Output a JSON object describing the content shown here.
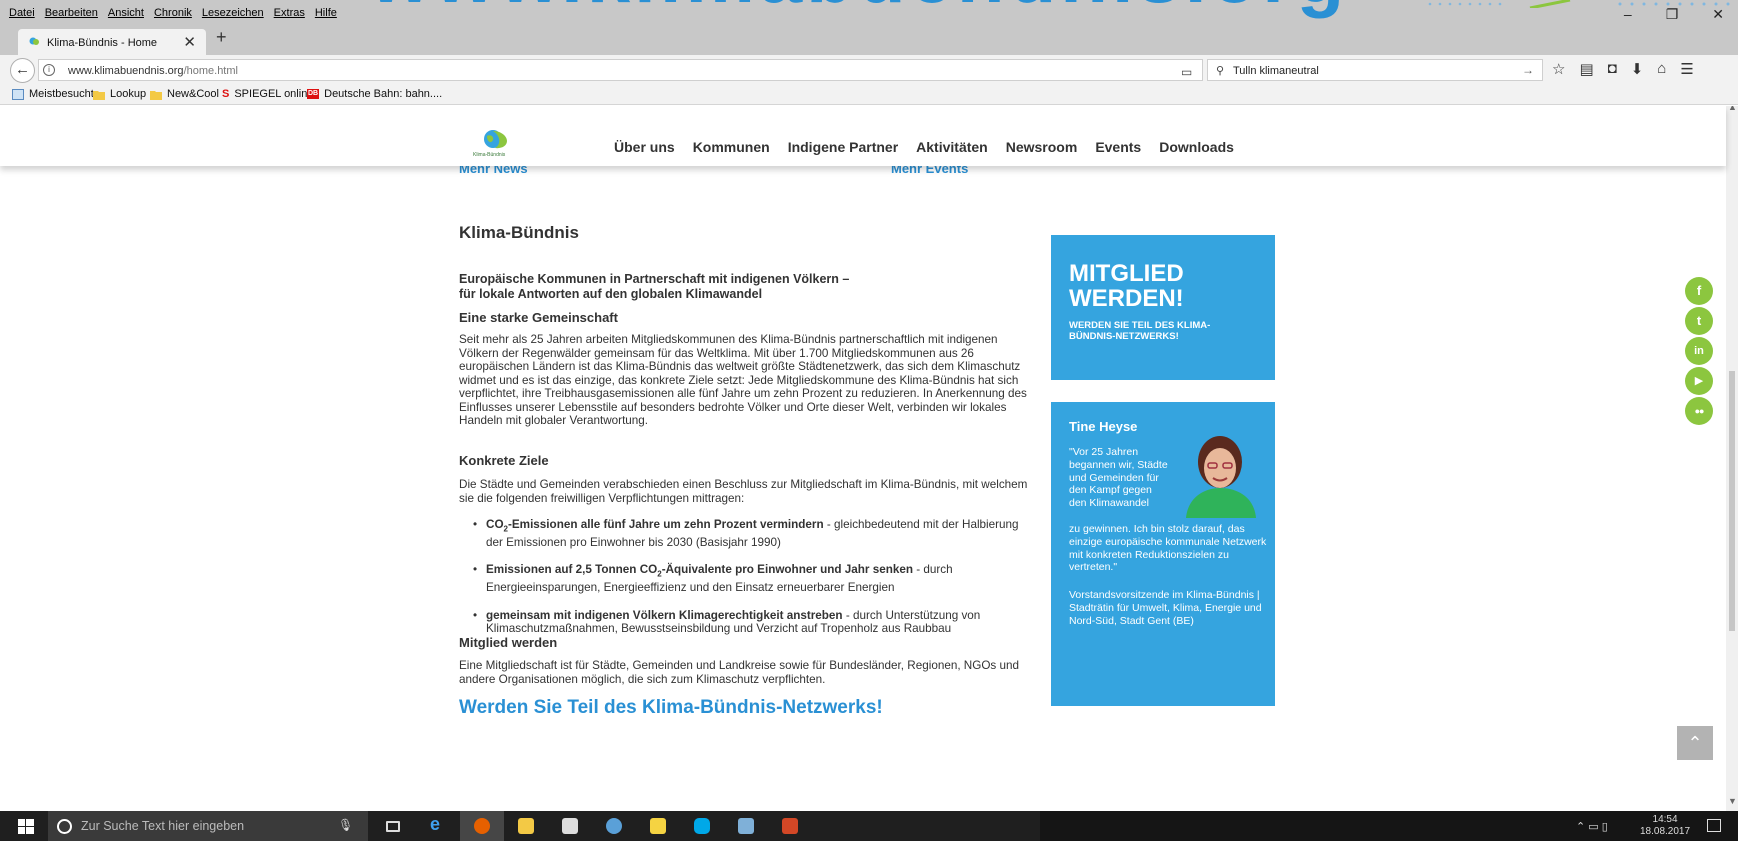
{
  "menu": [
    "Datei",
    "Bearbeiten",
    "Ansicht",
    "Chronik",
    "Lesezeichen",
    "Extras",
    "Hilfe"
  ],
  "banner_text": "www.klimabuendnis.org",
  "tab": {
    "title": "Klima-Bündnis - Home",
    "close": "✕",
    "new": "+"
  },
  "window_controls": {
    "minimize": "–",
    "restore": "❐",
    "close": "✕"
  },
  "address": {
    "host": "www.klimabuendnis.org",
    "path": "/home.html"
  },
  "search": {
    "value": "Tulln klimaneutral"
  },
  "bookmarks": [
    "Meistbesucht",
    "Lookup",
    "New&Cool",
    "SPIEGEL online",
    "Deutsche Bahn: bahn...."
  ],
  "site": {
    "logo_text": "Klima-Bündnis",
    "nav": [
      "Über uns",
      "Kommunen",
      "Indigene Partner",
      "Aktivitäten",
      "Newsroom",
      "Events",
      "Downloads"
    ],
    "more_news": "Mehr News",
    "more_events": "Mehr Events"
  },
  "content": {
    "title": "Klima-Bündnis",
    "lead_1": "Europäische Kommunen in Partnerschaft mit indigenen Völkern –",
    "lead_2": "für lokale Antworten auf den globalen Klimawandel",
    "h_community": "Eine starke Gemeinschaft",
    "p_community": "Seit mehr als 25 Jahren arbeiten Mitgliedskommunen des Klima-Bündnis partnerschaftlich mit indigenen Völkern der Regenwälder gemeinsam für das Weltklima. Mit über 1.700 Mitgliedskommunen aus 26 europäischen Ländern ist das Klima-Bündnis das weltweit größte Städtenetzwerk, das sich dem Klimaschutz widmet und es ist das einzige, das konkrete Ziele setzt: Jede Mitgliedskommune des Klima-Bündnis hat sich verpflichtet, ihre Treibhausgasemissionen alle fünf Jahre um zehn Prozent zu reduzieren. In Anerkennung des Einflusses unserer Lebensstile auf besonders bedrohte Völker und Orte dieser Welt, verbinden wir lokales Handeln mit globaler Verantwortung.",
    "h_goals": "Konkrete Ziele",
    "p_goals": "Die Städte und Gemeinden verabschieden einen Beschluss zur Mitgliedschaft im Klima-Bündnis, mit welchem sie die folgenden freiwilligen Verpflichtungen mittragen:",
    "goal_1_bold_a": "CO",
    "goal_1_sub": "2",
    "goal_1_bold_b": "-Emissionen alle fünf Jahre um zehn Prozent vermindern",
    "goal_1_rest": " - gleichbedeutend mit der Halbierung der Emissionen pro Einwohner bis 2030 (Basisjahr 1990)",
    "goal_2_bold_a": "Emissionen auf 2,5 Tonnen CO",
    "goal_2_sub": "2",
    "goal_2_bold_b": "-Äquivalente pro Einwohner und Jahr senken",
    "goal_2_rest": " - durch Energieeinsparungen, Energieeffizienz und den Einsatz erneuerbarer Energien",
    "goal_3_bold": "gemeinsam mit indigenen Völkern Klimagerechtigkeit anstreben",
    "goal_3_rest": " - durch Unterstützung von Klimaschutzmaßnahmen, Bewusstseinsbildung und Verzicht auf Tropenholz aus Raubbau",
    "h_member": "Mitglied werden",
    "p_member": "Eine Mitgliedschaft ist für Städte, Gemeinden und Landkreise sowie für Bundesländer, Regionen, NGOs und andere Organisationen möglich, die sich zum Klimaschutz verpflichten.",
    "cta": "Werden Sie Teil des Klima-Bündnis-Netzwerks!"
  },
  "sidebar": {
    "member_big_1": "MITGLIED",
    "member_big_2": "WERDEN!",
    "member_small": "WERDEN SIE TEIL DES KLIMA-BÜNDNIS-NETZWERKS!",
    "quote_name": "Tine Heyse",
    "quote_1": "\"Vor 25 Jahren begannen wir, Städte und Gemeinden für den Kampf gegen den Klimawandel",
    "quote_2": "zu gewinnen. Ich bin stolz darauf, das einzige europäische kommunale Netzwerk mit konkreten Reduktionszielen zu vertreten.\"",
    "quote_role": "Vorstandsvorsitzende im Klima-Bündnis | Stadträtin für Umwelt, Klima, Energie und Nord-Süd, Stadt Gent (BE)"
  },
  "social": [
    "f",
    "t",
    "in",
    "▶",
    "●●"
  ],
  "scroll_top": "⌃",
  "taskbar": {
    "search_placeholder": "Zur Suche Text hier eingeben",
    "time": "14:54",
    "date": "18.08.2017"
  },
  "colors": {
    "brand_blue": "#35a4df",
    "link_blue": "#2a90d4",
    "social_green": "#8cc63f"
  }
}
